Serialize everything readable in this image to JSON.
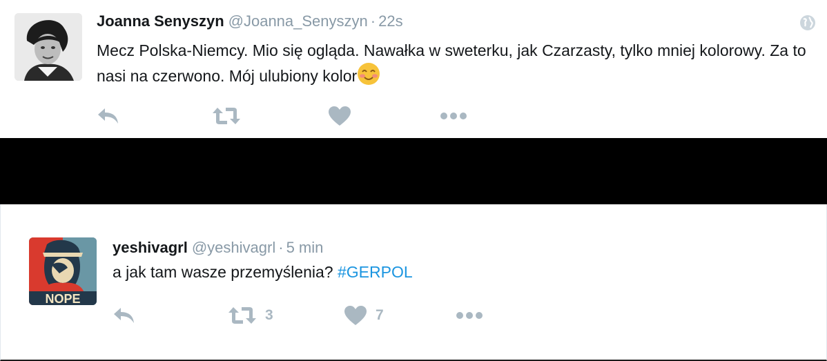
{
  "tweets": [
    {
      "fullname": "Joanna Senyszyn",
      "username": "@Joanna_Senyszyn",
      "separator": "·",
      "time": "22s",
      "text": "Mecz Polska-Niemcy. Mio się ogląda. Nawałka w sweterku, jak Czarzasty, tylko mniej kolorowy. Za to nasi na czerwono. Mój ulubiony kolor",
      "emoji": "smiling-face-with-blush-icon",
      "has_globe_icon": true,
      "retweet_count": "",
      "like_count": ""
    },
    {
      "fullname": "yeshivagrl",
      "username": "@yeshivagrl",
      "separator": "·",
      "time": "5 min",
      "text": "a jak tam wasze przemyślenia?",
      "hashtag": "#GERPOL",
      "avatar_caption": "NOPE",
      "retweet_count": "3",
      "like_count": "7"
    }
  ],
  "colors": {
    "action_icon": "#aab8c2",
    "hashtag": "#1b95e0",
    "meta_text": "#8899a6",
    "divider_bar": "#000000"
  }
}
